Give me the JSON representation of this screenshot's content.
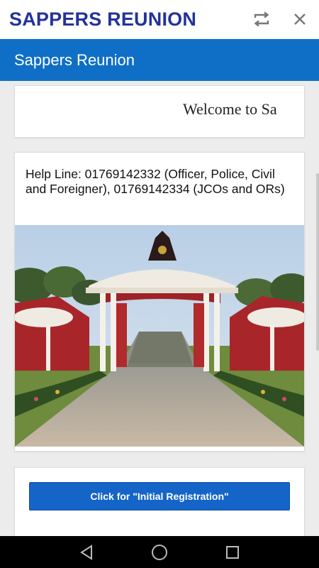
{
  "header": {
    "title": "SAPPERS REUNION",
    "refresh_icon": "refresh-icon",
    "close_icon": "close-icon"
  },
  "appbar": {
    "title": "Sappers Reunion"
  },
  "welcome": {
    "marquee_text": "Welcome to Sa"
  },
  "info": {
    "helpline": "Help Line: 01769142332 (Officer, Police, Civil and Foreigner), 01769142334 (JCOs and ORs)"
  },
  "registration": {
    "button_label": "Click for \"Initial Registration\""
  },
  "colors": {
    "header_title": "#23339a",
    "appbar": "#0f6fc6",
    "button": "#1565c8"
  },
  "navbar": {
    "back_icon": "back-icon",
    "home_icon": "home-icon",
    "recents_icon": "recents-icon"
  }
}
